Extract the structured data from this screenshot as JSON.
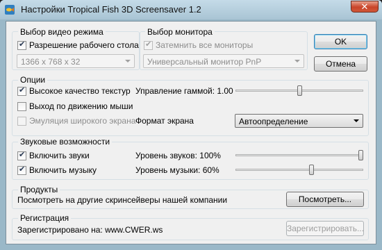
{
  "window": {
    "title": "Настройки Tropical Fish 3D Screensaver 1.2",
    "close_label": "✕"
  },
  "video_mode": {
    "label": "Выбор видео режима",
    "desktop_resolution_label": "Разрешение рабочего стола",
    "desktop_resolution_checked": true,
    "resolution_value": "1366 x 768 x 32"
  },
  "monitor": {
    "label": "Выбор монитора",
    "dim_all_label": "Затемнить все мониторы",
    "dim_all_checked": true,
    "monitor_value": "Универсальный монитор PnP"
  },
  "buttons": {
    "ok": "OK",
    "cancel": "Отмена"
  },
  "options": {
    "label": "Опции",
    "high_quality_label": "Высокое качество текстур",
    "high_quality_checked": true,
    "exit_mouse_label": "Выход по движению мыши",
    "exit_mouse_checked": false,
    "widescreen_label": "Эмуляция широкого экрана",
    "widescreen_checked": false,
    "gamma_label": "Управление гаммой: 1.00",
    "gamma_level": 0.5,
    "screen_format_label": "Формат экрана",
    "screen_format_value": "Автоопределение"
  },
  "sound": {
    "label": "Звуковые возможности",
    "sounds_label": "Включить звуки",
    "sounds_checked": true,
    "music_label": "Включить музыку",
    "music_checked": true,
    "sound_level_label": "Уровень звуков: 100%",
    "sound_level": 1.0,
    "music_level_label": "Уровень музыки: 60%",
    "music_level": 0.6
  },
  "products": {
    "label": "Продукты",
    "text": "Посмотреть на другие скринсейверы нашей компании",
    "button": "Посмотреть..."
  },
  "registration": {
    "label": "Регистрация",
    "text": "Зарегистрировано на: www.CWER.ws",
    "button": "Зарегистрировать..."
  }
}
